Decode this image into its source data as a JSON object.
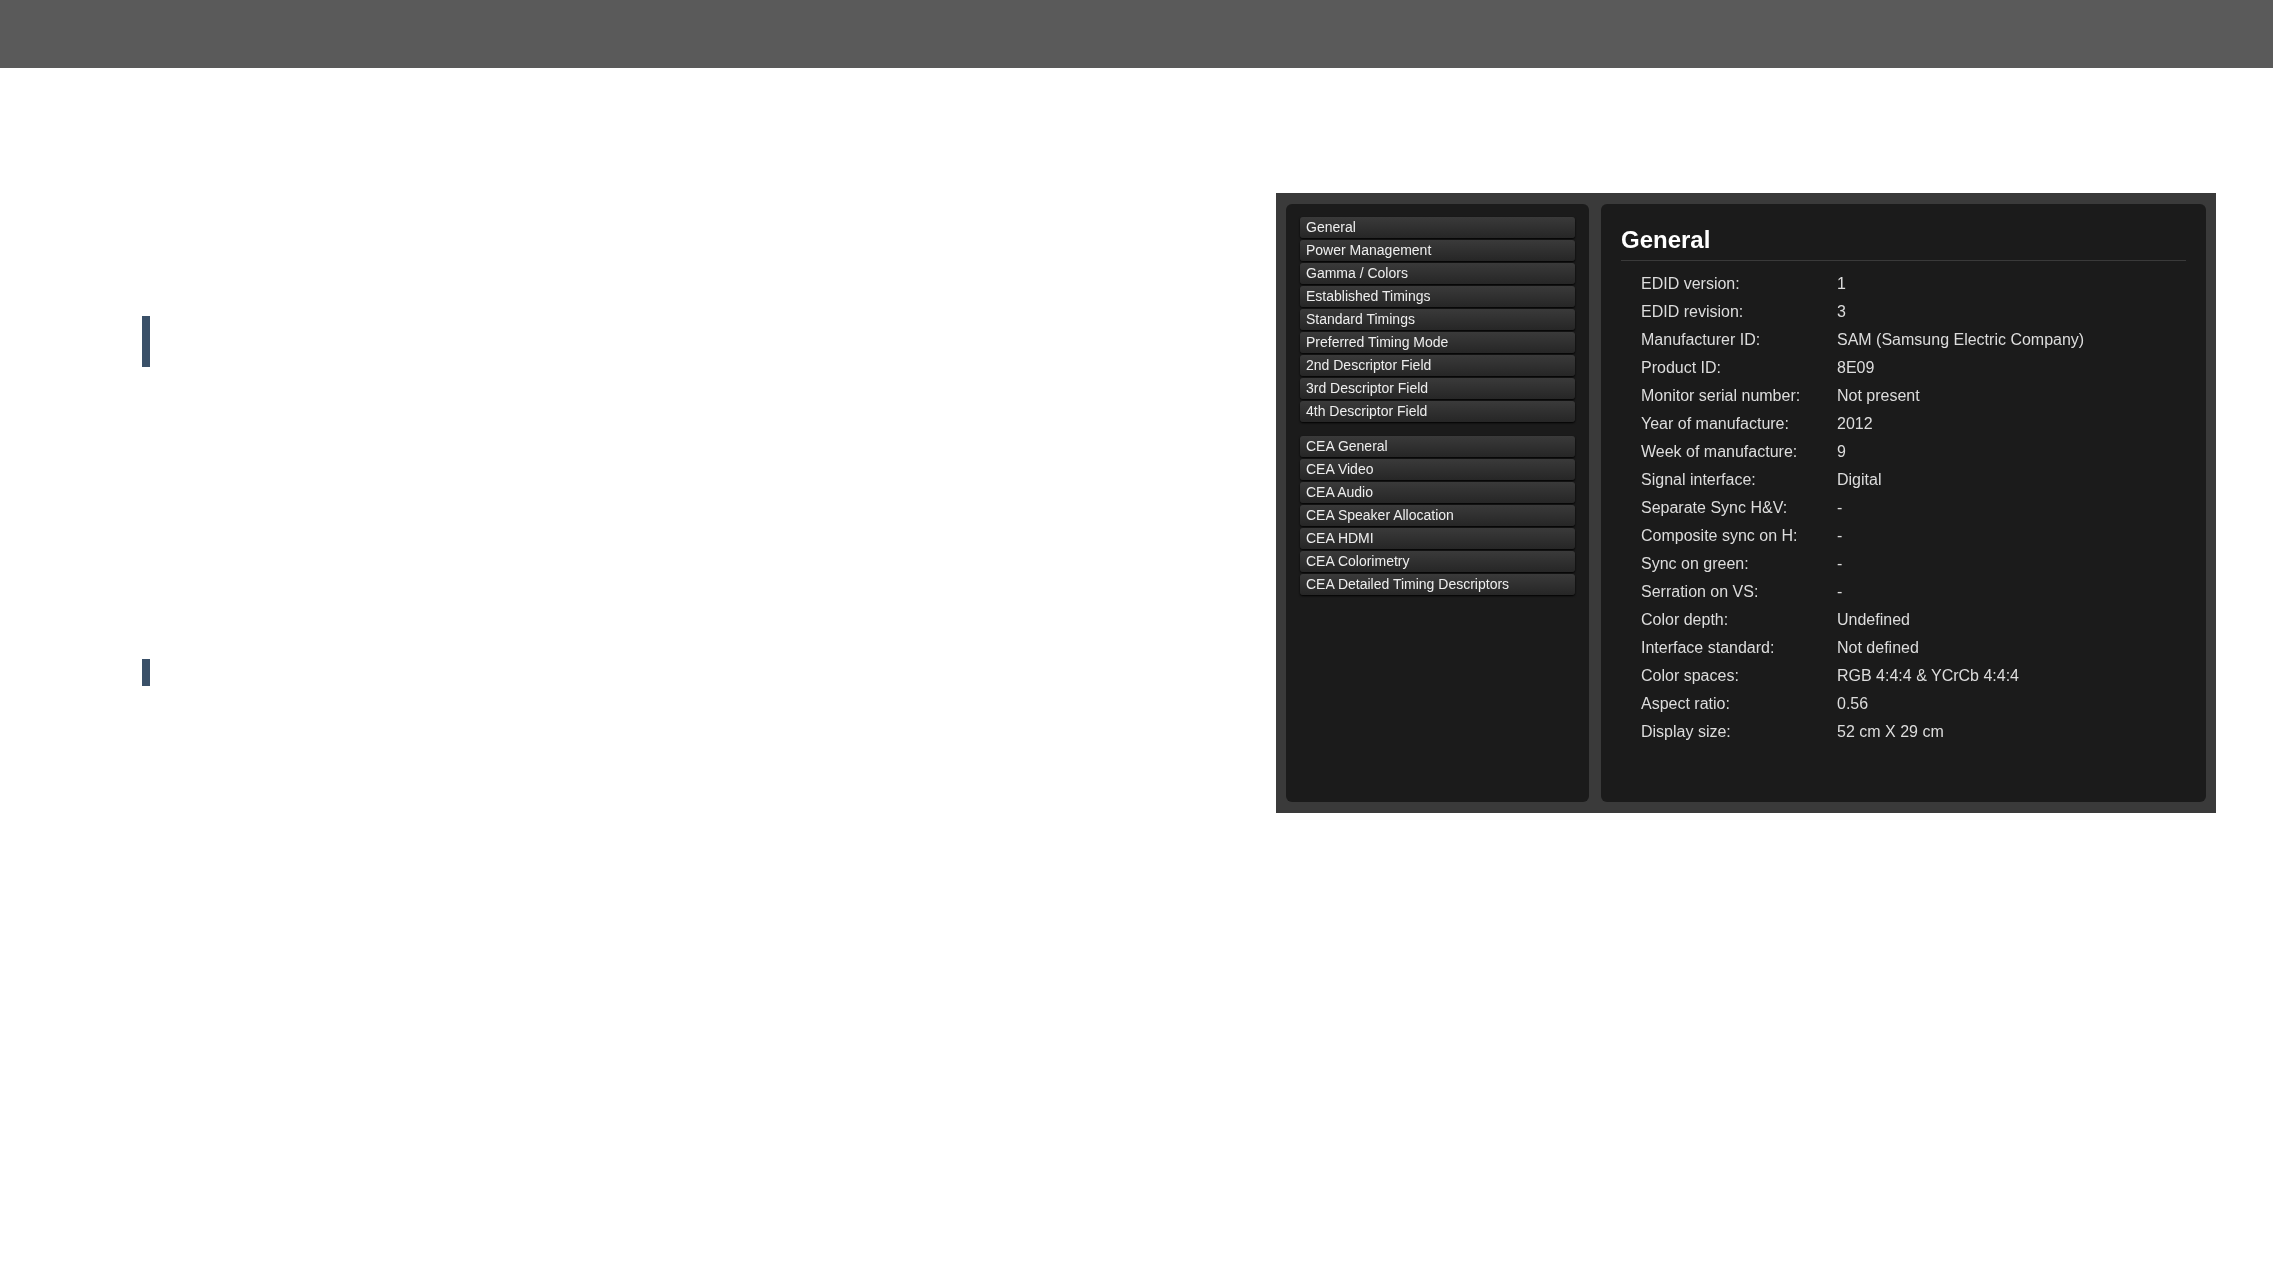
{
  "sidebar": {
    "groups": [
      {
        "items": [
          "General",
          "Power Management",
          "Gamma / Colors",
          "Established Timings",
          "Standard Timings",
          "Preferred Timing Mode",
          "2nd Descriptor Field",
          "3rd Descriptor Field",
          "4th Descriptor Field"
        ]
      },
      {
        "items": [
          "CEA General",
          "CEA Video",
          "CEA Audio",
          "CEA Speaker Allocation",
          "CEA HDMI",
          "CEA Colorimetry",
          "CEA Detailed Timing Descriptors"
        ]
      }
    ]
  },
  "details": {
    "title": "General",
    "rows": [
      {
        "label": "EDID version:",
        "value": "1"
      },
      {
        "label": "EDID revision:",
        "value": "3"
      },
      {
        "label": "Manufacturer ID:",
        "value": "SAM (Samsung Electric Company)"
      },
      {
        "label": "Product ID:",
        "value": "8E09"
      },
      {
        "label": "Monitor serial number:",
        "value": "Not present"
      },
      {
        "label": "Year of manufacture:",
        "value": "2012"
      },
      {
        "label": "Week of manufacture:",
        "value": "9"
      },
      {
        "label": "Signal interface:",
        "value": "Digital"
      },
      {
        "label": "Separate Sync H&V:",
        "value": "-"
      },
      {
        "label": "Composite sync on H:",
        "value": "-"
      },
      {
        "label": "Sync on green:",
        "value": "-"
      },
      {
        "label": "Serration on VS:",
        "value": "-"
      },
      {
        "label": "Color depth:",
        "value": "Undefined"
      },
      {
        "label": "Interface standard:",
        "value": "Not defined"
      },
      {
        "label": "Color spaces:",
        "value": "RGB 4:4:4 & YCrCb 4:4:4"
      },
      {
        "label": "Aspect ratio:",
        "value": "0.56"
      },
      {
        "label": "Display size:",
        "value": "52 cm X 29 cm"
      }
    ]
  }
}
